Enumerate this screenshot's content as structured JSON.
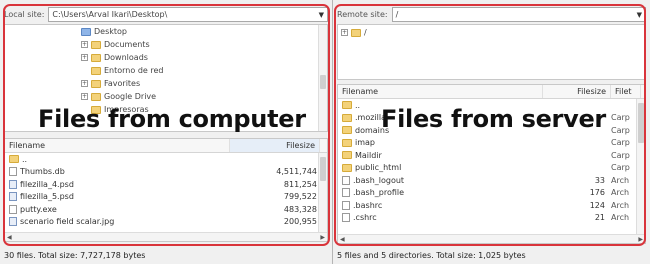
{
  "local": {
    "site_label": "Local site:",
    "path": "C:\\Users\\Arval Ikari\\Desktop\\",
    "tree": [
      "Desktop",
      "Documents",
      "Downloads",
      "Entorno de red",
      "Favorites",
      "Google Drive",
      "Impresoras"
    ],
    "headers": {
      "name": "Filename",
      "size": "Filesize"
    },
    "files": [
      {
        "name": "..",
        "size": ""
      },
      {
        "name": "Thumbs.db",
        "size": "4,511,744"
      },
      {
        "name": "filezilla_4.psd",
        "size": "811,254"
      },
      {
        "name": "filezilla_5.psd",
        "size": "799,522"
      },
      {
        "name": "putty.exe",
        "size": "483,328"
      },
      {
        "name": "scenario field scalar.jpg",
        "size": "200,955"
      }
    ],
    "status": "30 files. Total size: 7,727,178 bytes",
    "overlay_text": "Files from computer"
  },
  "remote": {
    "site_label": "Remote site:",
    "path": "/",
    "tree_root": "/",
    "headers": {
      "name": "Filename",
      "size": "Filesize",
      "type": "Filet"
    },
    "files": [
      {
        "name": "..",
        "size": "",
        "type": ""
      },
      {
        "name": ".mozilla",
        "size": "",
        "type": "Carp"
      },
      {
        "name": "domains",
        "size": "",
        "type": "Carp"
      },
      {
        "name": "imap",
        "size": "",
        "type": "Carp"
      },
      {
        "name": "Maildir",
        "size": "",
        "type": "Carp"
      },
      {
        "name": "public_html",
        "size": "",
        "type": "Carp"
      },
      {
        "name": ".bash_logout",
        "size": "33",
        "type": "Arch"
      },
      {
        "name": ".bash_profile",
        "size": "176",
        "type": "Arch"
      },
      {
        "name": ".bashrc",
        "size": "124",
        "type": "Arch"
      },
      {
        "name": ".cshrc",
        "size": "21",
        "type": "Arch"
      }
    ],
    "status": "5 files and 5 directories. Total size: 1,025 bytes",
    "overlay_text": "Files from server"
  },
  "colors": {
    "highlight": "#d9343b",
    "folder": "#f3d27a"
  }
}
